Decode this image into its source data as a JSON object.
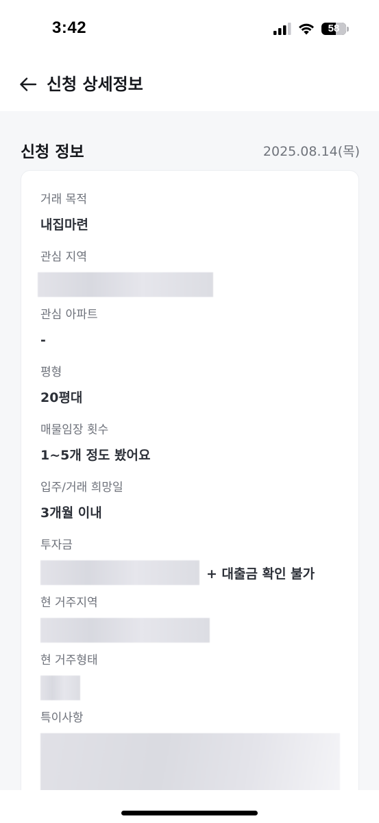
{
  "status_bar": {
    "time": "3:42",
    "battery_level": "58"
  },
  "header": {
    "title": "신청 상세정보"
  },
  "section": {
    "title": "신청 정보",
    "date": "2025.08.14(목)"
  },
  "fields": {
    "purpose": {
      "label": "거래 목적",
      "value": "내집마련"
    },
    "region": {
      "label": "관심 지역"
    },
    "apartment": {
      "label": "관심 아파트",
      "value": "-"
    },
    "size": {
      "label": "평형",
      "value": "20평대"
    },
    "visits": {
      "label": "매물임장 횟수",
      "value": "1~5개 정도 봤어요"
    },
    "move_in": {
      "label": "입주/거래 희망일",
      "value": "3개월 이내"
    },
    "investment": {
      "label": "투자금",
      "note": "+ 대출금 확인 불가"
    },
    "current_region": {
      "label": "현 거주지역"
    },
    "current_type": {
      "label": "현 거주형태"
    },
    "remarks": {
      "label": "특이사항"
    }
  },
  "colors": {
    "background": "#f6f7f9",
    "card": "#ffffff",
    "label": "#6c7079",
    "value": "#2c3038"
  },
  "icons": {
    "back": "arrow-left-icon",
    "signal": "cellular-signal-icon",
    "wifi": "wifi-icon",
    "battery": "battery-icon"
  }
}
